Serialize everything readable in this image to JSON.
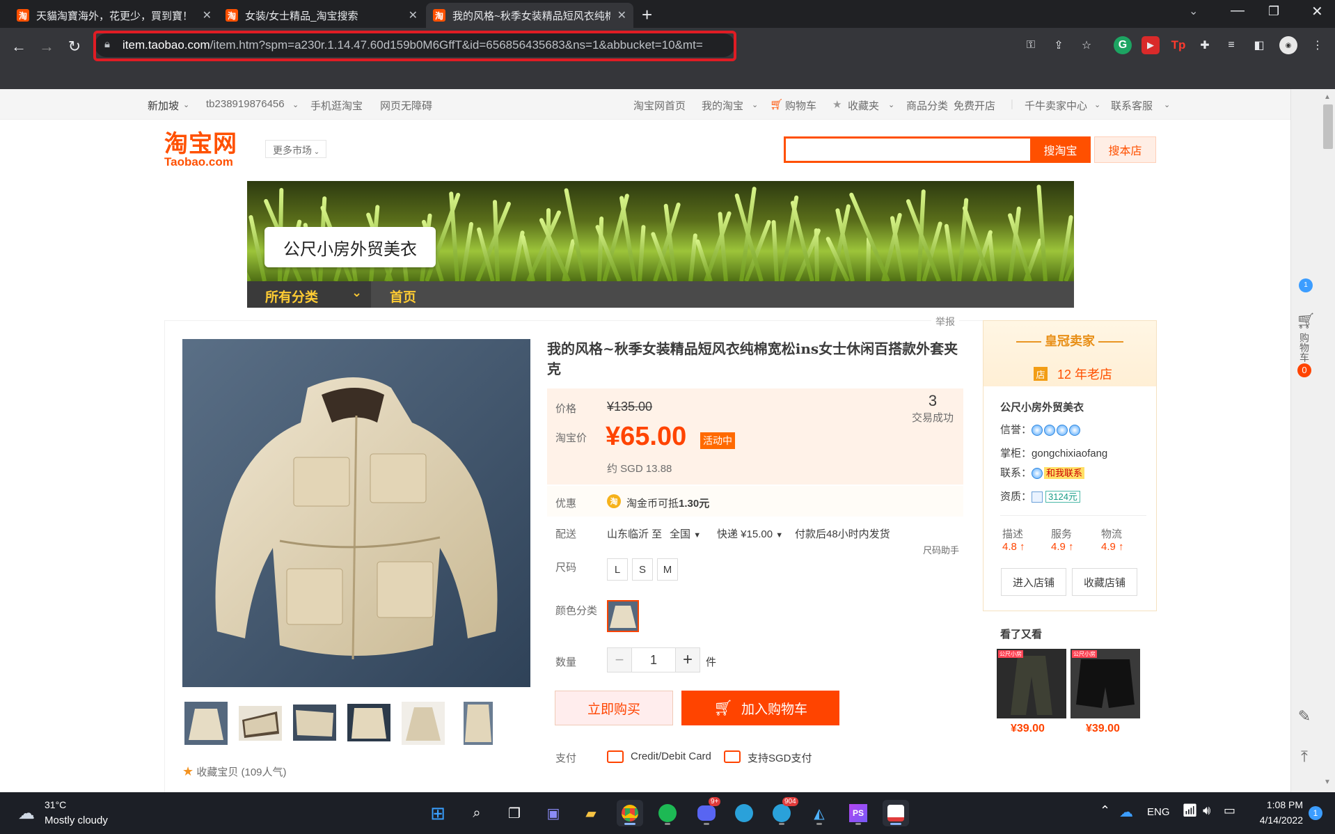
{
  "browser": {
    "tabs": [
      {
        "title": "天貓淘寶海外，花更少，買到寶！",
        "icon": "淘"
      },
      {
        "title": "女装/女士精品_淘宝搜索",
        "icon": "淘"
      },
      {
        "title": "我的风格~秋季女装精品短风衣纯棉宽松ins女士休闲百搭款外套夹克",
        "icon": "淘"
      }
    ],
    "url_host": "item.taobao.com",
    "url_path": "/item.htm?spm=a230r.1.14.47.60d159b0M6GffT&id=656856435683&ns=1&abbucket=10&mt="
  },
  "sitebar": {
    "region": "新加坡",
    "user": "tb238919876456",
    "mobile": "手机逛淘宝",
    "access": "网页无障碍",
    "home": "淘宝网首页",
    "mytaobao": "我的淘宝",
    "cart": "购物车",
    "favs": "收藏夹",
    "category": "商品分类",
    "openshop": "免费开店",
    "seller": "千牛卖家中心",
    "service": "联系客服"
  },
  "header": {
    "logo_cn": "淘宝网",
    "logo_en": "Taobao.com",
    "more_markets": "更多市场",
    "search_btn": "搜淘宝",
    "search_shop_btn": "搜本店",
    "search_value": ""
  },
  "shop": {
    "name": "公尺小房外贸美衣",
    "nav_all": "所有分类",
    "nav_home": "首页"
  },
  "product": {
    "report": "举报",
    "title": "我的风格~秋季女装精品短风衣纯棉宽松ins女士休闲百搭款外套夹克",
    "price_label": "价格",
    "old_price": "¥135.00",
    "tb_price_label": "淘宝价",
    "new_price": "¥65.00",
    "badge": "活动中",
    "sgd": "约 SGD 13.88",
    "sold_count": "3",
    "sold_label": "交易成功",
    "promo_label": "优惠",
    "coin_icon": "淘",
    "promo_text": "淘金币可抵",
    "promo_amount": "1.30元",
    "ship_label": "配送",
    "ship_from": "山东临沂 至",
    "ship_to": "全国",
    "ship_fee": "快递 ¥15.00",
    "ship_time": "付款后48小时内发货",
    "size_helper": "尺码助手",
    "size_label": "尺码",
    "sizes": [
      "L",
      "S",
      "M"
    ],
    "color_label": "颜色分类",
    "qty_label": "数量",
    "qty": "1",
    "qty_minus": "−",
    "qty_plus": "+",
    "qty_unit": "件",
    "buy_now": "立即购买",
    "add_cart": "加入购物车",
    "pay_label": "支付",
    "pay1": "Credit/Debit Card",
    "pay2": "支持SGD支付",
    "fav_text": "收藏宝贝 (109人气)"
  },
  "seller": {
    "crown": "皇冠卖家",
    "age_icon": "店",
    "age": "12 年老店",
    "shop_name": "公尺小房外贸美衣",
    "rep_label": "信誉：",
    "owner_label": "掌柜：",
    "owner": "gongchixiaofang",
    "contact_label": "联系：",
    "contact_btn": "和我联系",
    "qual_label": "资质：",
    "qual_amount": "3124元",
    "scores": [
      {
        "k": "描述",
        "v": "4.8"
      },
      {
        "k": "服务",
        "v": "4.9"
      },
      {
        "k": "物流",
        "v": "4.9"
      }
    ],
    "enter_shop": "进入店铺",
    "fav_shop": "收藏店铺",
    "see_also": "看了又看",
    "recs": [
      {
        "price": "¥39.00",
        "tag": "公尺小房"
      },
      {
        "price": "¥39.00",
        "tag": "公尺小房"
      }
    ]
  },
  "sidetools": {
    "cart": "购物车",
    "cart_count": "0"
  },
  "taskbar": {
    "temp": "31°C",
    "weather": "Mostly cloudy",
    "lang": "ENG",
    "time": "1:08 PM",
    "date": "4/14/2022",
    "discord_badge": "9+",
    "telegram_badge": "904",
    "notif": "1"
  }
}
